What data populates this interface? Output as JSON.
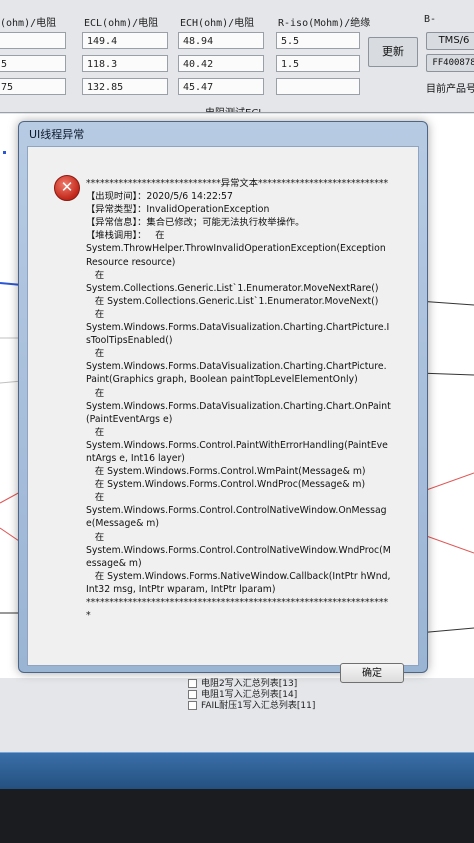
{
  "table": {
    "headers": [
      "(ohm)/电阻",
      "ECL(ohm)/电阻",
      "ECH(ohm)/电阻",
      "R-iso(Mohm)/绝缘",
      "B-"
    ],
    "rows": [
      [
        "",
        "149.4",
        "48.94",
        "5.5"
      ],
      [
        "5",
        "118.3",
        "40.42",
        "1.5"
      ],
      [
        "75",
        "132.85",
        "45.47",
        ""
      ]
    ]
  },
  "side": {
    "update_button": "更新",
    "tms_button": "TMS/6",
    "ff_button": "FF400878",
    "current_product_label": "目前产品号"
  },
  "chart": {
    "title": "电阻测试ECL",
    "legend": [
      "电阻2写入汇总列表[13]",
      "电阻1写入汇总列表[14]",
      "FAIL耐压1写入汇总列表[11]"
    ]
  },
  "dialog": {
    "title": "UI线程异常",
    "message": "*****************************异常文本****************************\n【出现时间】：2020/5/6 14:22:57\n【异常类型】：InvalidOperationException\n【异常信息】：集合已修改；可能无法执行枚举操作。\n【堆栈调用】：   在\nSystem.ThrowHelper.ThrowInvalidOperationException(ExceptionResource resource)\n   在\nSystem.Collections.Generic.List`1.Enumerator.MoveNextRare()\n   在 System.Collections.Generic.List`1.Enumerator.MoveNext()\n   在\nSystem.Windows.Forms.DataVisualization.Charting.ChartPicture.IsToolTipsEnabled()\n   在\nSystem.Windows.Forms.DataVisualization.Charting.ChartPicture.Paint(Graphics graph, Boolean paintTopLevelElementOnly)\n   在\nSystem.Windows.Forms.DataVisualization.Charting.Chart.OnPaint(PaintEventArgs e)\n   在\nSystem.Windows.Forms.Control.PaintWithErrorHandling(PaintEventArgs e, Int16 layer)\n   在 System.Windows.Forms.Control.WmPaint(Message& m)\n   在 System.Windows.Forms.Control.WndProc(Message& m)\n   在\nSystem.Windows.Forms.Control.ControlNativeWindow.OnMessage(Message& m)\n   在\nSystem.Windows.Forms.Control.ControlNativeWindow.WndProc(Message& m)\n   在 System.Windows.Forms.NativeWindow.Callback(IntPtr hWnd, Int32 msg, IntPtr wparam, IntPtr lparam)\n******************************************************************",
    "ok_button": "确定"
  },
  "colors": {
    "chart_line_red": "#e05555",
    "chart_line_blue": "#2b57d6",
    "chart_line_dark": "#333333"
  }
}
